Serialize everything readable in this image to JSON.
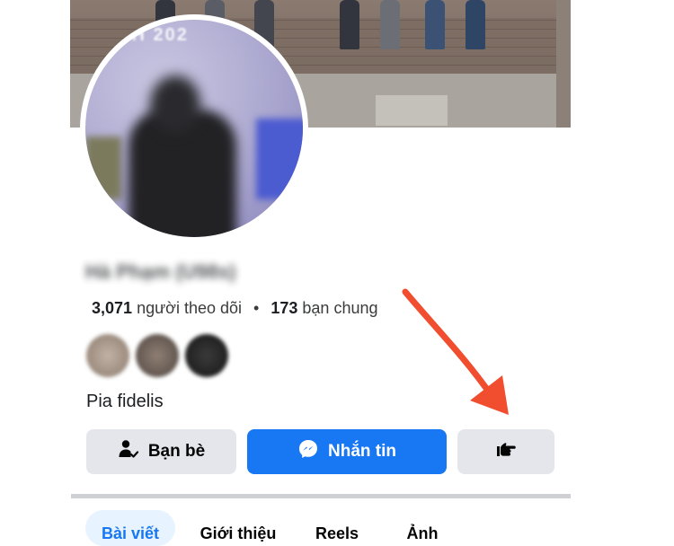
{
  "profile": {
    "name": "Hà Phạm (U98s)",
    "followers_count": "3,071",
    "followers_label": "người theo dõi",
    "separator": "•",
    "mutual_count": "173",
    "mutual_label": "bạn chung",
    "bio": "Pia fidelis",
    "avatar_banner_text": "GH 202"
  },
  "actions": {
    "friends_label": "Bạn bè",
    "message_label": "Nhắn tin",
    "friends_icon": "friend-check-icon",
    "message_icon": "messenger-icon",
    "more_icon": "pointing-hand-icon"
  },
  "mutual_avatars": [
    {
      "color": "#9b8c80"
    },
    {
      "color": "#6f625a"
    },
    {
      "color": "#2a2a2a"
    }
  ],
  "tabs": [
    {
      "label": "Bài viết",
      "active": true
    },
    {
      "label": "Giới thiệu",
      "active": false
    },
    {
      "label": "Reels",
      "active": false
    },
    {
      "label": "Ảnh",
      "active": false
    }
  ],
  "colors": {
    "accent": "#1877f2",
    "annotation_arrow": "#f04e2f"
  }
}
